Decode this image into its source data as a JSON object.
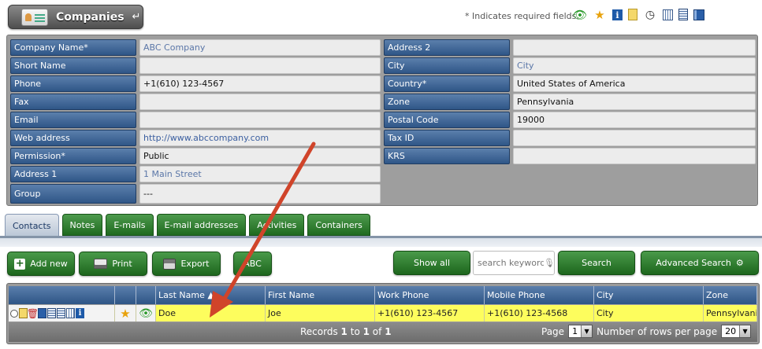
{
  "header": {
    "title": "Companies",
    "title_arrow": "↵",
    "required_note": "* Indicates required fields.",
    "icons": [
      "eye-icon",
      "star-icon",
      "info-icon",
      "notes-icon",
      "clock-icon",
      "calendar-icon",
      "document-icon",
      "book-icon"
    ]
  },
  "form": {
    "left": [
      {
        "label": "Company Name*",
        "value": "ABC Company"
      },
      {
        "label": "Short Name",
        "value": ""
      },
      {
        "label": "Phone",
        "value": "+1(610) 123-4567"
      },
      {
        "label": "Fax",
        "value": ""
      },
      {
        "label": "Email",
        "value": ""
      },
      {
        "label": "Web address",
        "value": "http://www.abccompany.com"
      },
      {
        "label": "Permission*",
        "value": "Public"
      },
      {
        "label": "Address 1",
        "value": "1 Main Street"
      },
      {
        "label": "Group",
        "value": "---"
      }
    ],
    "right": [
      {
        "label": "Address 2",
        "value": ""
      },
      {
        "label": "City",
        "value": "City"
      },
      {
        "label": "Country*",
        "value": "United States of America"
      },
      {
        "label": "Zone",
        "value": "Pennsylvania"
      },
      {
        "label": "Postal Code",
        "value": "19000"
      },
      {
        "label": "Tax ID",
        "value": ""
      },
      {
        "label": "KRS",
        "value": ""
      }
    ]
  },
  "tabs": [
    "Contacts",
    "Notes",
    "E-mails",
    "E-mail addresses",
    "Activities",
    "Containers"
  ],
  "active_tab": "Contacts",
  "toolbar": {
    "add_new": "Add new",
    "print": "Print",
    "export": "Export",
    "abc": "ABC",
    "show_all": "Show all",
    "search_placeholder": "search keyword...",
    "search": "Search",
    "advanced_search": "Advanced Search"
  },
  "table": {
    "columns": [
      "Last Name ▲",
      "First Name",
      "Work Phone",
      "Mobile Phone",
      "City",
      "Zone"
    ],
    "rows": [
      {
        "last_name": "Doe",
        "first_name": "Joe",
        "work_phone": "+1(610) 123-4567",
        "mobile_phone": "+1(610) 123-4568",
        "city": "City",
        "zone": "Pennsylvania"
      }
    ],
    "footer": {
      "records_prefix": "Records",
      "records_from": "1",
      "records_to_word": "to",
      "records_to": "1",
      "records_of_word": "of",
      "records_total": "1",
      "page_label": "Page",
      "page_value": "1",
      "rows_label": "Number of rows per page",
      "rows_value": "20"
    }
  },
  "colors": {
    "label_blue": "#2f5687",
    "button_green": "#1d661d",
    "row_highlight": "#fdfd5d",
    "arrow_red": "#d0442a"
  }
}
